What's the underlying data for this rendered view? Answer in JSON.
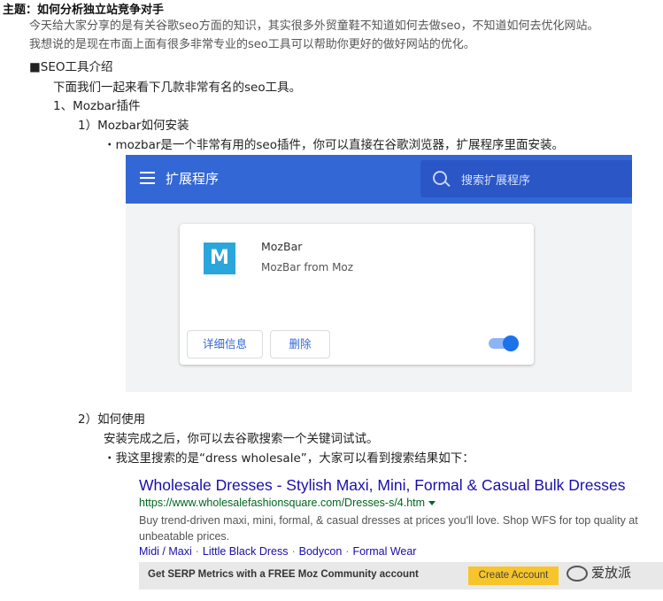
{
  "title": "主题：如何分析独立站竞争对手",
  "intro": [
    "今天给大家分享的是有关谷歌seo方面的知识，其实很多外贸童鞋不知道如何去做seo，不知道如何去优化网站。",
    "我想说的是现在市面上面有很多非常专业的seo工具可以帮助你更好的做好网站的优化。"
  ],
  "section_heading": "■SEO工具介绍",
  "lines": {
    "tools_intro": "下面我们一起来看下几款非常有名的seo工具。",
    "mozbar_plugin": "1、Mozbar插件",
    "install_heading": "1）Mozbar如何安装",
    "install_bullet": "・mozbar是一个非常有用的seo插件，你可以直接在谷歌浏览器，扩展程序里面安装。",
    "usage_heading": "2）如何使用",
    "usage_text": "安装完成之后，你可以去谷歌搜索一个关键词试试。",
    "usage_bullet": "・我这里搜索的是“dress wholesale”，大家可以看到搜索结果如下："
  },
  "extensions_page": {
    "bar_title": "扩展程序",
    "search_placeholder": "搜索扩展程序",
    "extension": {
      "logo_letter": "M",
      "name": "MozBar",
      "description": "MozBar from Moz",
      "details_button": "详细信息",
      "remove_button": "删除",
      "enabled": true
    },
    "colors": {
      "bar": "#3367d6",
      "toggle": "#1a73e8"
    }
  },
  "search_result": {
    "title": "Wholesale Dresses - Stylish Maxi, Mini, Formal & Casual Bulk Dresses",
    "url": "https://www.wholesalefashionsquare.com/Dresses-s/4.htm",
    "description_line1": "Buy trend-driven maxi, mini, formal, & casual dresses at prices you'll love. Shop WFS for top quality at",
    "description_line2": "unbeatable prices.",
    "sitelinks": [
      "Midi / Maxi",
      "Little Black Dress",
      "Bodycon",
      "Formal Wear"
    ],
    "sitelink_separator": "·"
  },
  "moz_bar": {
    "text": "Get SERP Metrics with a FREE Moz Community account",
    "button": "Create Account"
  },
  "watermark": "爱放派"
}
